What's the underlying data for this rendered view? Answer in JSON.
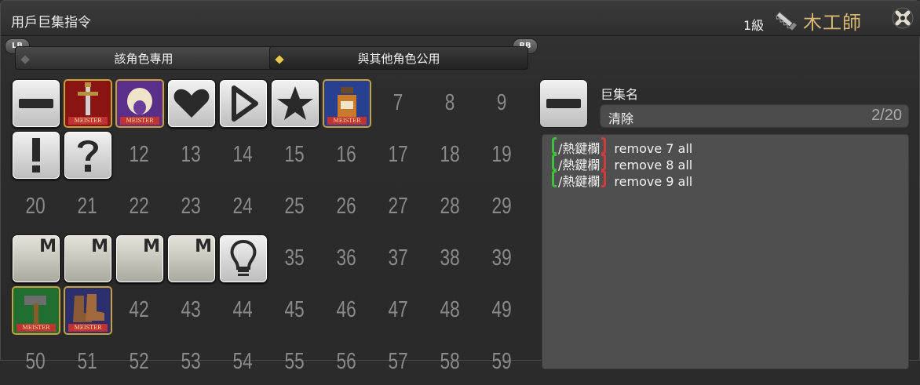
{
  "window": {
    "title": "用戶巨集指令",
    "level": "1級",
    "job": "木工師",
    "job_icon": "saw-icon",
    "close_icon": "close-icon"
  },
  "shoulders": {
    "left": "LB",
    "right": "RB"
  },
  "tabs": [
    {
      "label": "該角色專用",
      "active": false
    },
    {
      "label": "與其他角色公用",
      "active": true
    }
  ],
  "grid": {
    "rows": [
      [
        "",
        "",
        "",
        "",
        "",
        "",
        "",
        "7",
        "8",
        "9"
      ],
      [
        "",
        "",
        "12",
        "13",
        "14",
        "15",
        "16",
        "17",
        "18",
        "19"
      ],
      [
        "20",
        "21",
        "22",
        "23",
        "24",
        "25",
        "26",
        "27",
        "28",
        "29"
      ],
      [
        "",
        "",
        "",
        "",
        "",
        "35",
        "36",
        "37",
        "38",
        "39"
      ],
      [
        "",
        "",
        "42",
        "43",
        "44",
        "45",
        "46",
        "47",
        "48",
        "49"
      ],
      [
        "50",
        "51",
        "52",
        "53",
        "54",
        "55",
        "56",
        "57",
        "58",
        "59"
      ]
    ],
    "m_label": "M",
    "meister_label": "MEISTER"
  },
  "macro": {
    "name_label": "巨集名",
    "name": "清除",
    "line_count": "2/20",
    "lines": [
      {
        "command": "/熱鍵欄",
        "args": "remove 7 all"
      },
      {
        "command": "/熱鍵欄",
        "args": "remove 8 all"
      },
      {
        "command": "/熱鍵欄",
        "args": "remove 9 all"
      }
    ]
  },
  "colors": {
    "accent_gold": "#d7b973",
    "bracket_green": "#3ec03e",
    "bracket_red": "#d23c3c",
    "meister_red": "#c23232"
  }
}
